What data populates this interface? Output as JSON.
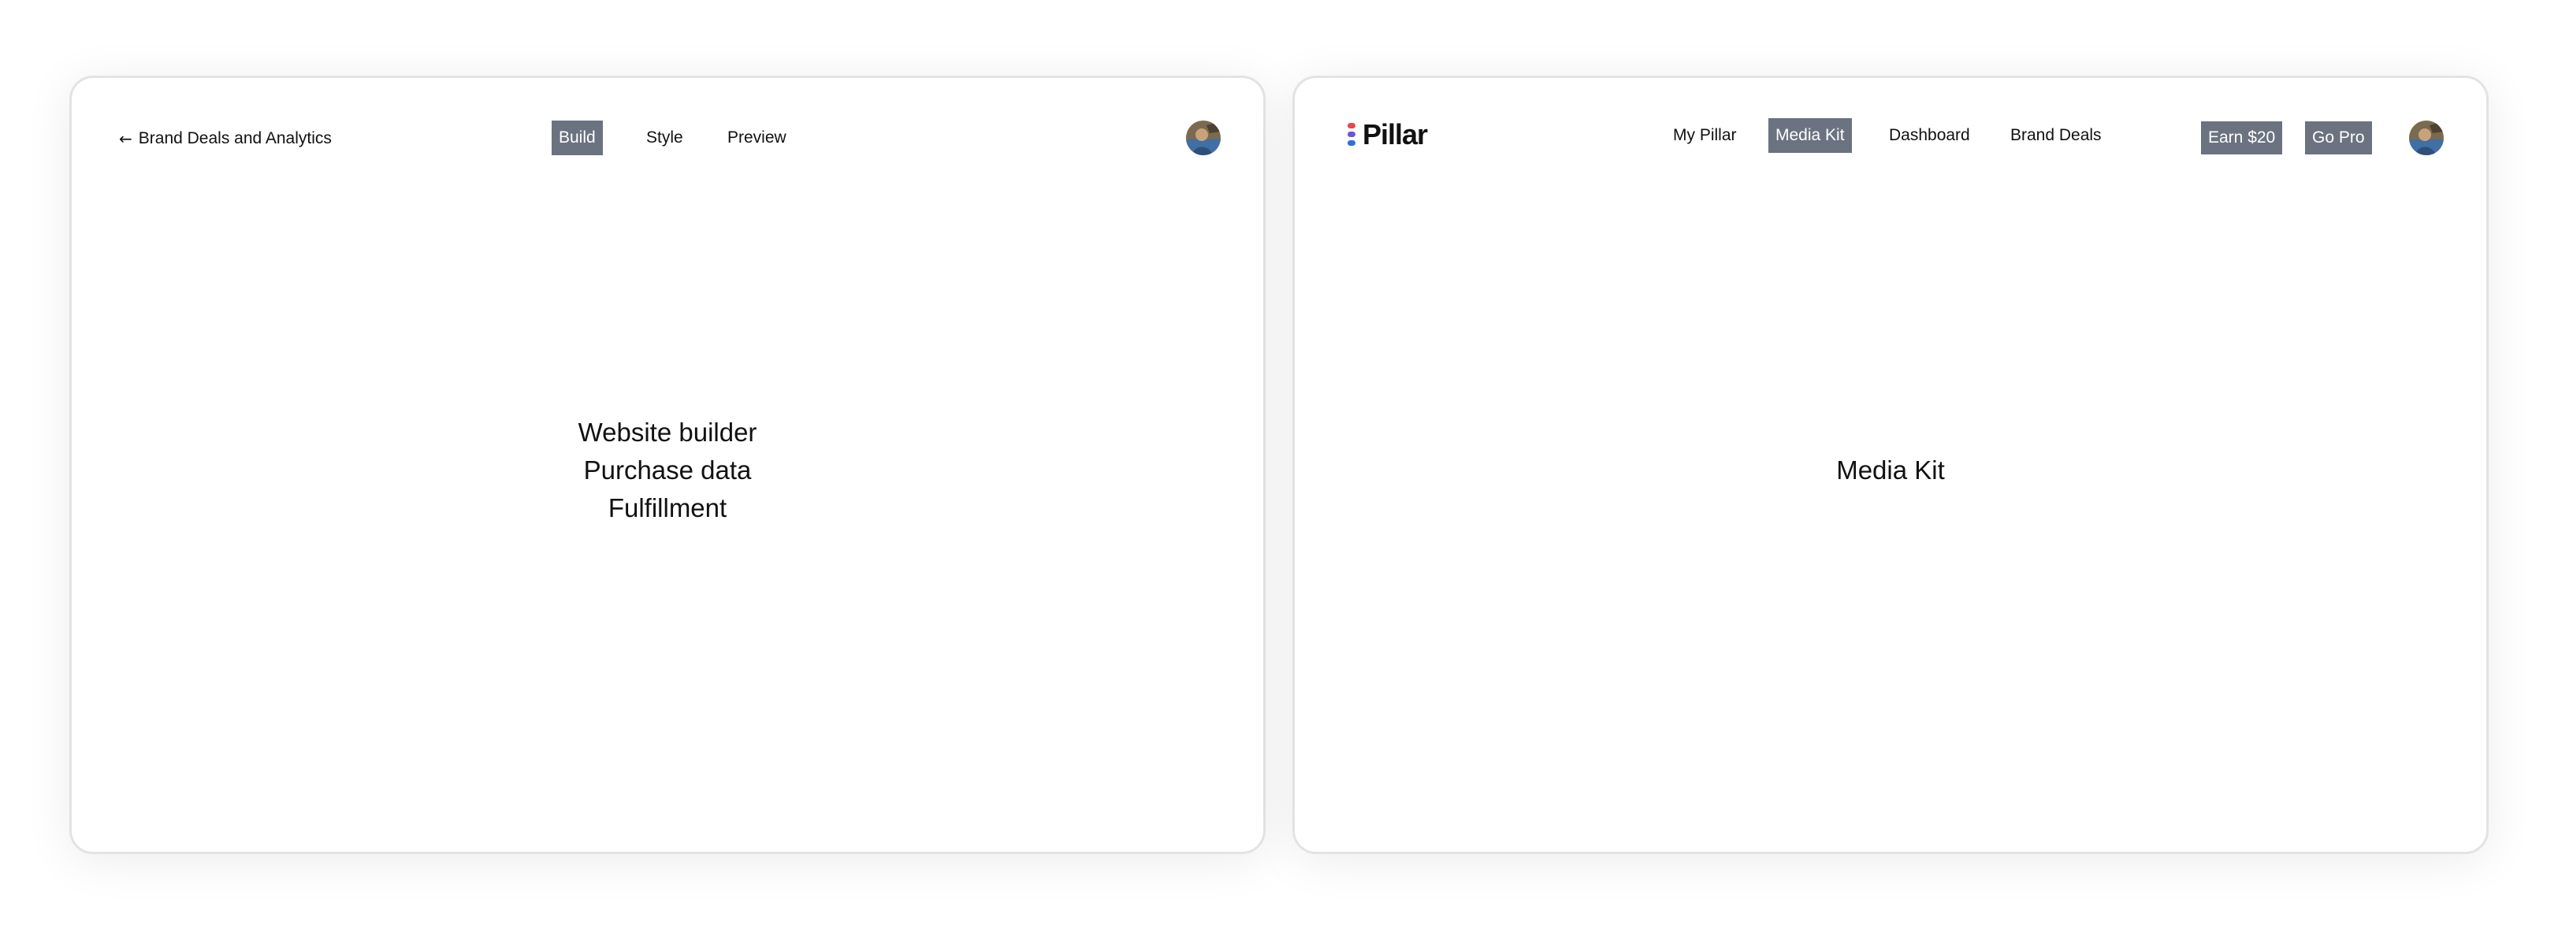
{
  "left_window": {
    "back_link": {
      "arrow": "←",
      "label": "Brand Deals and Analytics"
    },
    "tabs": [
      {
        "label": "Build",
        "active": true
      },
      {
        "label": "Style",
        "active": false
      },
      {
        "label": "Preview",
        "active": false
      }
    ],
    "content_lines": [
      "Website builder",
      "Purchase data",
      "Fulfillment"
    ]
  },
  "right_window": {
    "logo": {
      "text": "Pillar",
      "icon": "pillar-logo-icon"
    },
    "nav": [
      {
        "label": "My Pillar",
        "active": false
      },
      {
        "label": "Media Kit",
        "active": true
      },
      {
        "label": "Dashboard",
        "active": false
      },
      {
        "label": "Brand Deals",
        "active": false
      }
    ],
    "actions": {
      "earn_label": "Earn $20",
      "go_pro_label": "Go Pro"
    },
    "content_title": "Media Kit"
  },
  "colors": {
    "active_tab_bg": "#6b7280",
    "active_tab_text": "#ffffff",
    "window_border": "#e3e3e3",
    "logo_red": "#e5484d",
    "logo_purple": "#6e56cf",
    "logo_blue": "#2f6fe0"
  }
}
